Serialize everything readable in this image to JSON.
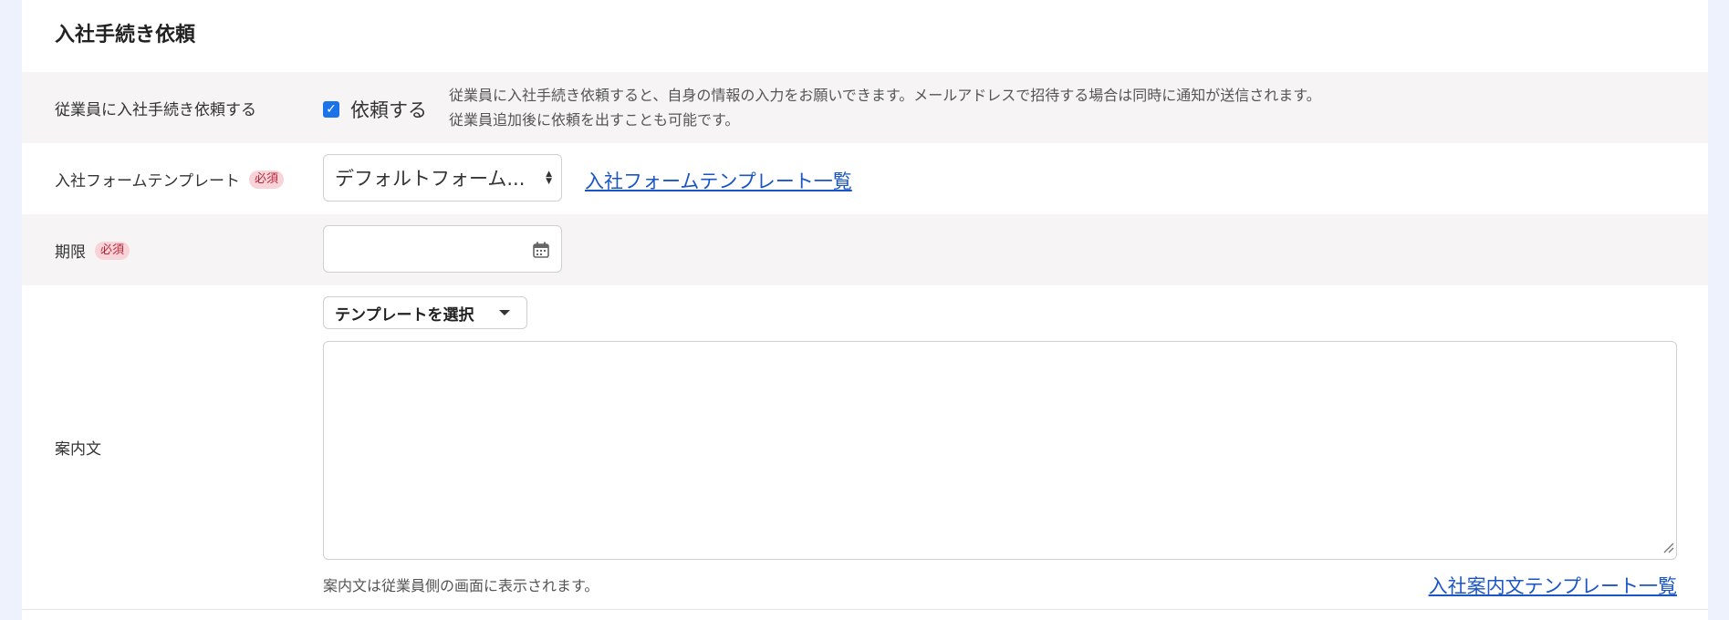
{
  "section": {
    "title": "入社手続き依頼"
  },
  "request_row": {
    "label": "従業員に入社手続き依頼する",
    "checkbox_label": "依頼する",
    "checked": true,
    "desc_line1": "従業員に入社手続き依頼すると、自身の情報の入力をお願いできます。メールアドレスで招待する場合は同時に通知が送信されます。",
    "desc_line2": "従業員追加後に依頼を出すことも可能です。"
  },
  "form_template_row": {
    "label": "入社フォームテンプレート",
    "required_badge": "必須",
    "selected_value": "デフォルトフォーム...",
    "link_text": "入社フォームテンプレート一覧"
  },
  "deadline_row": {
    "label": "期限",
    "required_badge": "必須",
    "value": ""
  },
  "message_row": {
    "label": "案内文",
    "template_button": "テンプレートを選択",
    "textarea_value": "",
    "hint": "案内文は従業員側の画面に表示されます。",
    "link_text": "入社案内文テンプレート一覧"
  },
  "colors": {
    "accent": "#1a73e8",
    "link": "#1a55c6",
    "required_bg": "#f8d3d8",
    "required_text": "#b3263a"
  },
  "icons": {
    "calendar": "calendar-icon",
    "caret": "caret-down-icon",
    "check": "checkmark-icon"
  }
}
